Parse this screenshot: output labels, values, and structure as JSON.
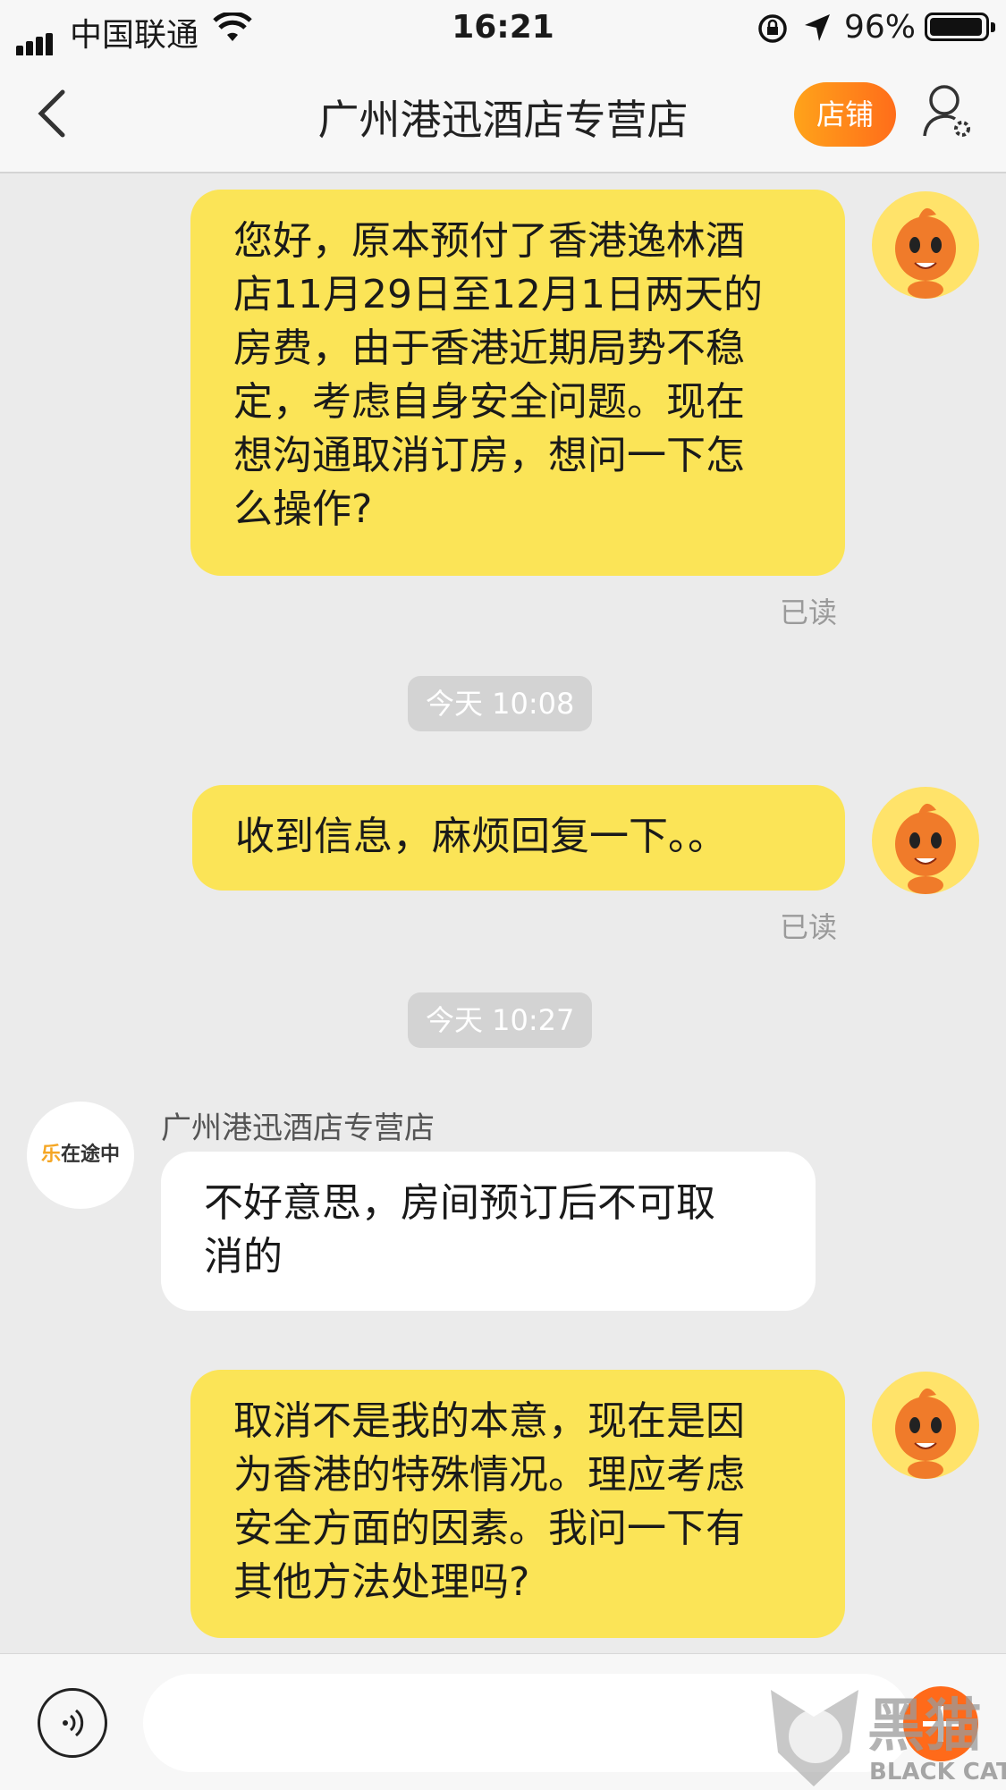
{
  "status_bar": {
    "carrier": "中国联通",
    "time": "16:21",
    "battery": "96%"
  },
  "nav": {
    "title": "广州港迅酒店专营店",
    "shop_button": "店铺"
  },
  "messages": [
    {
      "text": "您好，原本预付了香港逸林酒\n店11月29日至12月1日两天的\n房费，由于香港近期局势不稳\n定，考虑自身安全问题。现在\n想沟通取消订房，想问一下怎\n么操作?",
      "status": "已读"
    },
    {
      "time": "今天 10:08"
    },
    {
      "text": "收到信息，麻烦回复一下。。",
      "status": "已读"
    },
    {
      "time": "今天 10:27"
    },
    {
      "sender": "广州港迅酒店专营店",
      "avatar_text_1": "乐",
      "avatar_text_2": "在途中",
      "text": "不好意思，房间预订后不可取\n消的"
    },
    {
      "text": "取消不是我的本意，现在是因\n为香港的特殊情况。理应考虑\n安全方面的因素。我问一下有\n其他方法处理吗?"
    }
  ],
  "input": {
    "placeholder": ""
  },
  "watermark": {
    "text_1": "黑猫",
    "text_2": "BLACK CAT"
  },
  "colors": {
    "my_bubble": "#fbe457",
    "shop_button": "#ff6d1a",
    "background": "#ebebeb"
  }
}
